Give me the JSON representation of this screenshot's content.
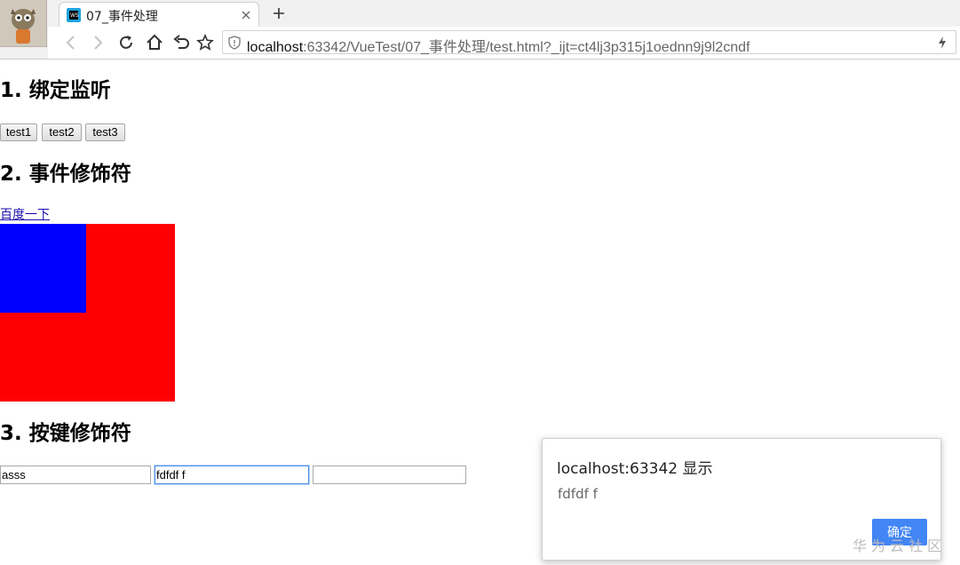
{
  "browser": {
    "tab": {
      "title": "07_事件处理"
    },
    "url": {
      "host": "localhost",
      "rest": ":63342/VueTest/07_事件处理/test.html?_ijt=ct4lj3p315j1oednn9j9l2cndf"
    }
  },
  "page": {
    "section1": {
      "heading": "1. 绑定监听",
      "buttons": [
        "test1",
        "test2",
        "test3"
      ]
    },
    "section2": {
      "heading": "2. 事件修饰符",
      "link": "百度一下",
      "colors": {
        "outer": "#ff0000",
        "inner": "#0000ff"
      }
    },
    "section3": {
      "heading": "3. 按键修饰符",
      "inputs": [
        {
          "value": "asss"
        },
        {
          "value": "fdfdf f"
        },
        {
          "value": ""
        }
      ]
    }
  },
  "dialog": {
    "title": "localhost:63342 显示",
    "message": "fdfdf f",
    "ok_label": "确定"
  },
  "watermark": "华为云社区"
}
